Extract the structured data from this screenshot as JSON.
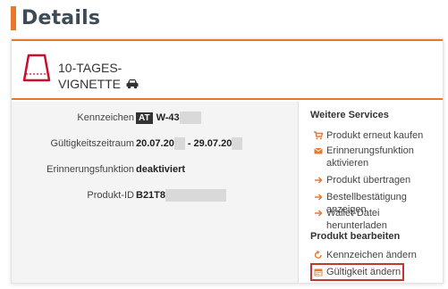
{
  "page": {
    "title": "Details"
  },
  "product": {
    "name_line1": "10-TAGES-",
    "name_line2": "VIGNETTE"
  },
  "details": {
    "plate": {
      "label": "Kennzeichen",
      "country": "AT",
      "value": "W-43"
    },
    "validity": {
      "label": "Gültigkeitszeitraum",
      "from": "20.07.20",
      "separator": "-",
      "to": "29.07.20"
    },
    "reminder": {
      "label": "Erinnerungsfunktion",
      "value": "deaktiviert"
    },
    "product_id": {
      "label": "Produkt-ID",
      "value": "B21T8"
    }
  },
  "services": {
    "heading": "Weitere Services",
    "items": [
      {
        "label": "Produkt erneut kaufen",
        "icon": "cart-icon"
      },
      {
        "label": "Erinnerungsfunktion aktivieren",
        "icon": "envelope-icon"
      },
      {
        "label": "Produkt übertragen",
        "icon": "arrow-right-icon"
      },
      {
        "label": "Bestellbestätigung anzeigen",
        "icon": "arrow-right-icon"
      },
      {
        "label": "Wallet-Datei herunterladen",
        "icon": "arrow-right-icon"
      }
    ]
  },
  "edit": {
    "heading": "Produkt bearbeiten",
    "items": [
      {
        "label": "Kennzeichen ändern",
        "icon": "refresh-icon"
      },
      {
        "label": "Gültigkeit ändern",
        "icon": "calendar-icon"
      }
    ]
  },
  "colors": {
    "accent": "#e8792b",
    "highlight_border": "#c0392b",
    "vignette_red": "#c8102e"
  }
}
